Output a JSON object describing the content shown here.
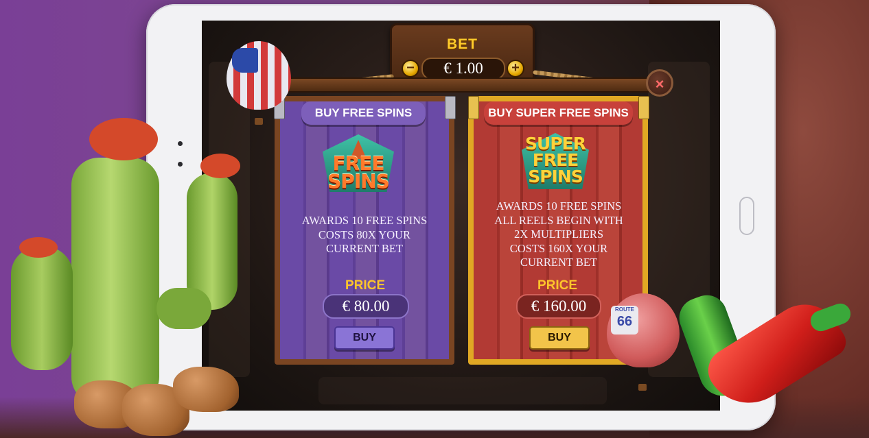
{
  "bet": {
    "title": "BET",
    "value": "€ 1.00",
    "minus": "−",
    "plus": "+"
  },
  "close_label": "×",
  "panels": {
    "left": {
      "tag": "BUY FREE SPINS",
      "logo_line1": "FREE",
      "logo_line2": "SPINS",
      "desc_line1": "AWARDS 10 FREE SPINS",
      "desc_line2": "COSTS 80x YOUR",
      "desc_line3": "CURRENT BET",
      "price_label": "PRICE",
      "price": "€ 80.00",
      "buy": "BUY"
    },
    "right": {
      "tag": "BUY SUPER FREE SPINS",
      "logo_line1": "SUPER",
      "logo_line2": "FREE",
      "logo_line3": "SPINS",
      "desc_line1": "AWARDS 10 FREE SPINS",
      "desc_line2": "ALL REELS BEGIN WITH",
      "desc_line3": "2x MULTIPLIERS",
      "desc_line4": "COSTS 160x YOUR",
      "desc_line5": "CURRENT BET",
      "price_label": "PRICE",
      "price": "€ 160.00",
      "buy": "BUY"
    }
  },
  "balloon_route": {
    "line1": "ROUTE",
    "line2": "66"
  },
  "colors": {
    "left_panel": "#6a4aa6",
    "right_panel": "#b23a34",
    "gold": "#ffc52a"
  }
}
